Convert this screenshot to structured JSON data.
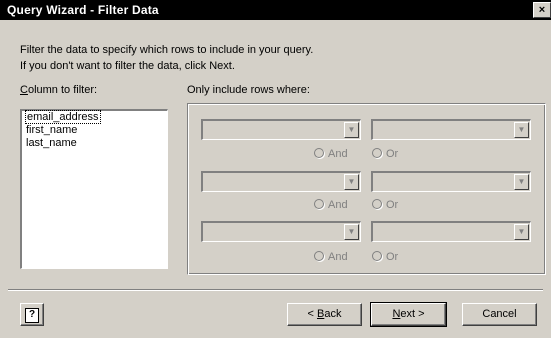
{
  "window": {
    "title": "Query Wizard - Filter Data",
    "close_label": "×"
  },
  "instructions": {
    "line1": "Filter the data to specify which rows to include in your query.",
    "line2": "If you don't want to filter the data, click Next."
  },
  "column_filter": {
    "label_accel": "C",
    "label_rest": "olumn to filter:",
    "items": [
      "email_address",
      "first_name",
      "last_name"
    ],
    "selected_index": 0
  },
  "conditions": {
    "label": "Only include rows where:",
    "rows": [
      {
        "and_label": "And",
        "or_label": "Or",
        "disabled": true
      },
      {
        "and_label": "And",
        "or_label": "Or",
        "disabled": true
      },
      {
        "and_label": "And",
        "or_label": "Or",
        "disabled": true
      }
    ]
  },
  "buttons": {
    "help_icon": "?",
    "back_prefix": "< ",
    "back_accel": "B",
    "back_rest": "ack",
    "next_accel": "N",
    "next_rest": "ext >",
    "cancel": "Cancel"
  }
}
